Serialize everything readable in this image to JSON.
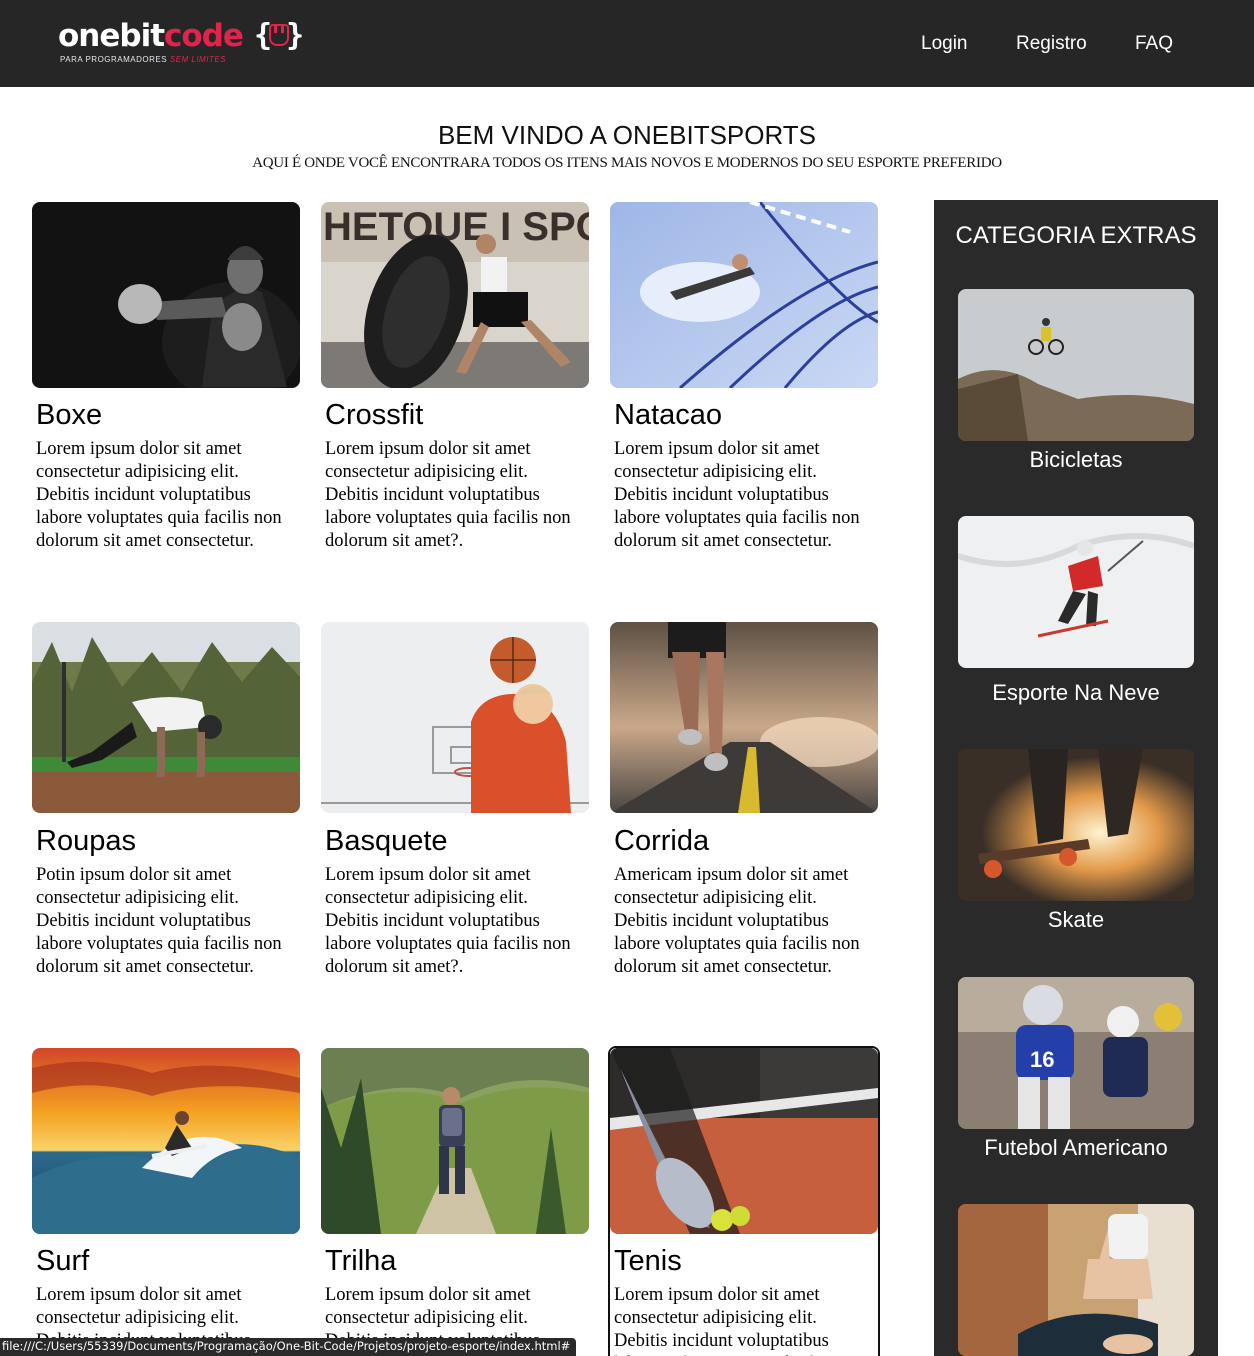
{
  "header": {
    "logo": {
      "word_one": "onebit",
      "word_two": "code",
      "brace_open": "{",
      "brace_close": "}",
      "tagline_a": "PARA PROGRAMADORES",
      "tagline_b": "SEM LIMITES"
    },
    "nav": [
      {
        "label": "Login"
      },
      {
        "label": "Registro"
      },
      {
        "label": "FAQ"
      }
    ]
  },
  "intro": {
    "title": "BEM VINDO A ONEBITSPORTS",
    "subtitle": "AQUI É ONDE VOCÊ ENCONTRARA TODOS OS ITENS MAIS NOVOS E MODERNOS DO SEU ESPORTE PREFERIDO"
  },
  "cards": [
    {
      "title": "Boxe",
      "text": "Lorem ipsum dolor sit amet consectetur adipisicing elit. Debitis incidunt voluptatibus labore voluptates quia facilis non dolorum sit amet consectetur.",
      "image": "boxer-photo"
    },
    {
      "title": "Crossfit",
      "text": "Lorem ipsum dolor sit amet consectetur adipisicing elit. Debitis incidunt voluptatibus labore voluptates quia facilis non dolorum sit amet?.",
      "image": "tire-flip-photo"
    },
    {
      "title": "Natacao",
      "text": "Lorem ipsum dolor sit amet consectetur adipisicing elit. Debitis incidunt voluptatibus labore voluptates quia facilis non dolorum sit amet consectetur.",
      "image": "swimmer-photo"
    },
    {
      "title": "Roupas",
      "text": "Potin ipsum dolor sit amet consectetur adipisicing elit. Debitis incidunt voluptatibus labore voluptates quia facilis non dolorum sit amet consectetur.",
      "image": "workout-photo"
    },
    {
      "title": "Basquete",
      "text": "Lorem ipsum dolor sit amet consectetur adipisicing elit. Debitis incidunt voluptatibus labore voluptates quia facilis non dolorum sit amet?.",
      "image": "basketball-photo"
    },
    {
      "title": "Corrida",
      "text": "Americam ipsum dolor sit amet consectetur adipisicing elit. Debitis incidunt voluptatibus labore voluptates quia facilis non dolorum sit amet consectetur.",
      "image": "runner-photo"
    },
    {
      "title": "Surf",
      "text": "Lorem ipsum dolor sit amet consectetur adipisicing elit. Debitis incidunt voluptatibus labore voluptates quia facilis non dolorum sit amet consectetur.",
      "image": "surfer-photo"
    },
    {
      "title": "Trilha",
      "text": "Lorem ipsum dolor sit amet consectetur adipisicing elit. Debitis incidunt voluptatibus labore voluptates quia facilis non dolorum sit amet?.",
      "image": "hiker-photo"
    },
    {
      "title": "Tenis",
      "text": "Lorem ipsum dolor sit amet consectetur adipisicing elit. Debitis incidunt voluptatibus labore voluptates quia facilis non dolorum sit amet consectetur.",
      "image": "tennis-photo"
    }
  ],
  "sidebar": {
    "title": "CATEGORIA EXTRAS",
    "items": [
      {
        "label": "Bicicletas",
        "image": "mountain-bike-photo"
      },
      {
        "label": "Esporte Na Neve",
        "image": "skier-photo"
      },
      {
        "label": "Skate",
        "image": "skateboard-photo"
      },
      {
        "label": "Futebol Americano",
        "image": "football-photo"
      },
      {
        "label": "",
        "image": "yoga-photo"
      }
    ]
  },
  "status_bar": {
    "url": "file:///C:/Users/55339/Documents/Programação/One-Bit-Code/Projetos/projeto-esporte/index.html#"
  },
  "colors": {
    "header_bg": "#262626",
    "sidebar_bg": "#2b2a2a",
    "brand_accent": "#e0244b"
  }
}
